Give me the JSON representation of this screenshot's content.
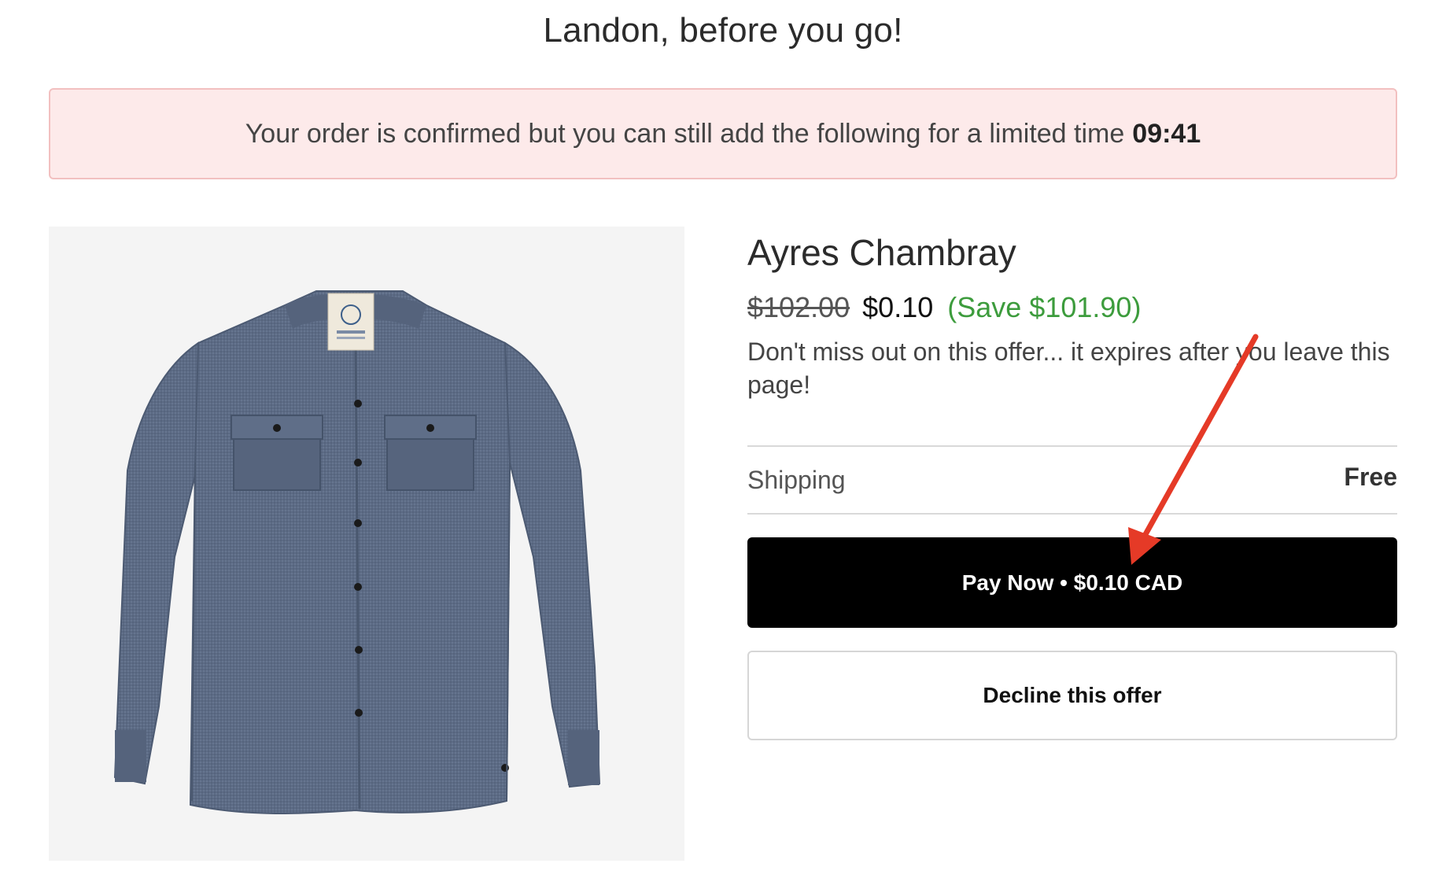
{
  "page": {
    "title": "Landon, before you go!"
  },
  "banner": {
    "message": "Your order is confirmed but you can still add the following for a limited time",
    "timer": "09:41",
    "background_color": "#fdeaea",
    "border_color": "#f2c0c0"
  },
  "product": {
    "image_icon": "chambray-shirt-image",
    "name": "Ayres Chambray",
    "original_price": "$102.00",
    "price": "$0.10",
    "savings": "(Save $101.90)",
    "savings_color": "#3d9c3d",
    "offer_note": "Don't miss out on this offer... it expires after you leave this page!"
  },
  "shipping": {
    "label": "Shipping",
    "value": "Free"
  },
  "actions": {
    "pay_label": "Pay Now • $0.10 CAD",
    "decline_label": "Decline this offer"
  },
  "annotation": {
    "icon": "red-arrow-annotation",
    "color": "#e53a27"
  }
}
